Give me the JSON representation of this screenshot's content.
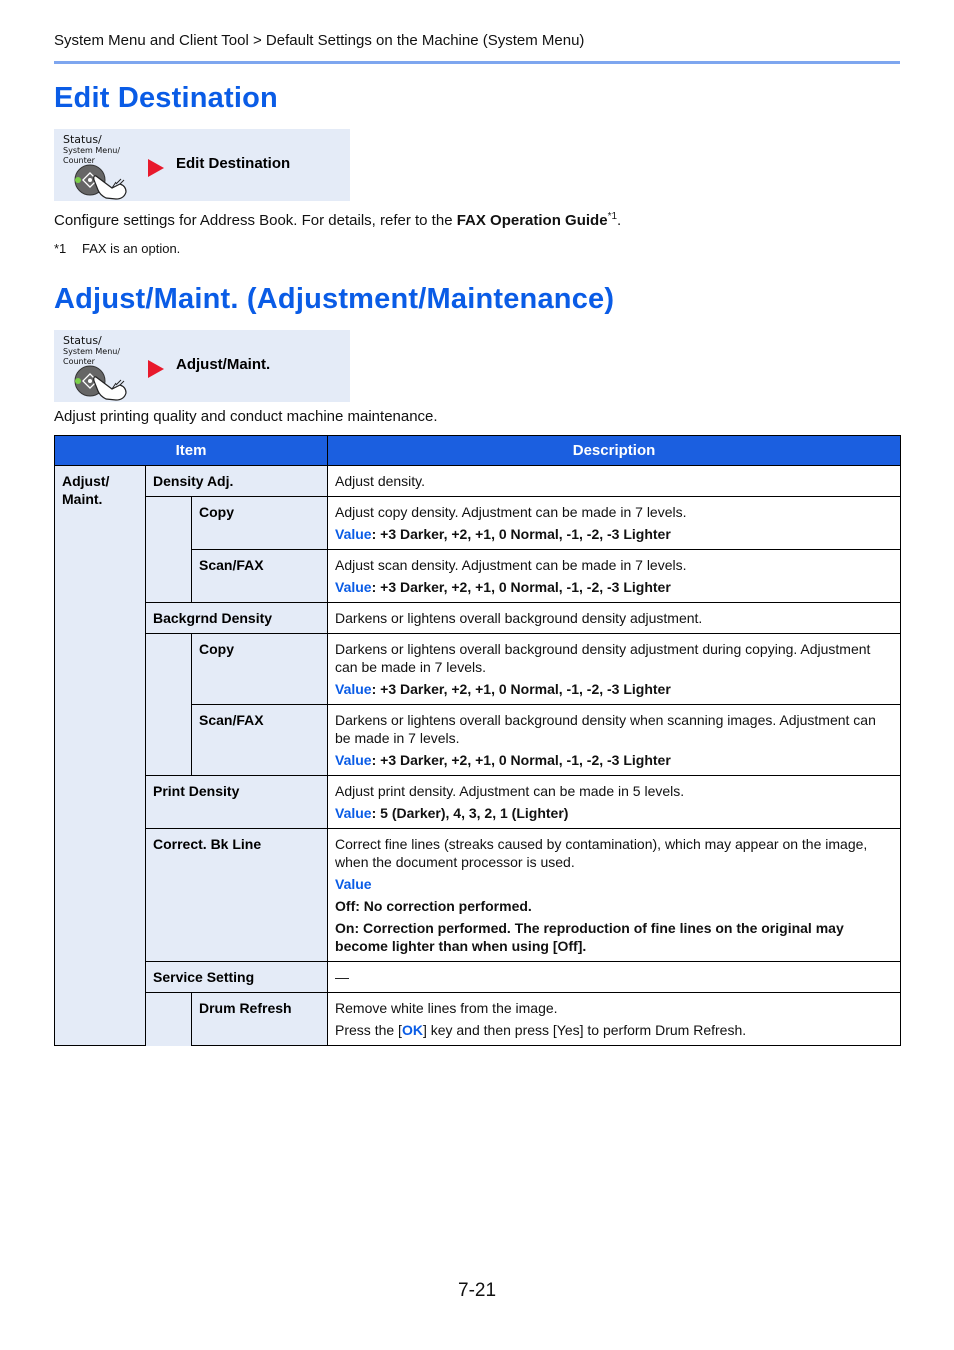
{
  "header": {
    "breadcrumb": "System Menu and Client Tool > Default Settings on the Machine (System Menu)"
  },
  "sections": [
    {
      "title": "Edit Destination",
      "nav": {
        "key_label_line1": "Status/",
        "key_label_line2": "System Menu/",
        "key_label_line3": "Counter",
        "path": "Edit Destination"
      },
      "body_prefix": "Configure settings for Address Book. For details, refer to the ",
      "body_bold": "FAX Operation Guide",
      "body_sup": "*1",
      "body_suffix": ".",
      "footnote_mark": "*1",
      "footnote_text": "FAX is an option."
    },
    {
      "title": "Adjust/Maint. (Adjustment/Maintenance)",
      "nav": {
        "key_label_line1": "Status/",
        "key_label_line2": "System Menu/",
        "key_label_line3": "Counter",
        "path": "Adjust/Maint."
      },
      "body": "Adjust printing quality and conduct machine maintenance."
    }
  ],
  "table": {
    "headers": {
      "item": "Item",
      "description": "Description"
    },
    "root_item": "Adjust/\nMaint.",
    "value_label": "Value",
    "rows": [
      {
        "level": 2,
        "item": "Density Adj.",
        "desc": "Adjust density."
      },
      {
        "level": 3,
        "item": "Copy",
        "desc": "Adjust copy density. Adjustment can be made in 7 levels.",
        "value": ": +3 Darker, +2, +1, 0 Normal, -1, -2, -3 Lighter"
      },
      {
        "level": 3,
        "item": "Scan/FAX",
        "desc": "Adjust scan density. Adjustment can be made in 7 levels.",
        "value": ": +3 Darker, +2, +1, 0 Normal, -1, -2, -3 Lighter"
      },
      {
        "level": 2,
        "item": "Backgrnd Density",
        "desc": "Darkens or lightens overall background density adjustment."
      },
      {
        "level": 3,
        "item": "Copy",
        "desc": "Darkens or lightens overall background density adjustment during copying. Adjustment can be made in 7 levels.",
        "value": ": +3 Darker, +2, +1, 0 Normal, -1, -2, -3 Lighter"
      },
      {
        "level": 3,
        "item": "Scan/FAX",
        "desc": "Darkens or lightens overall background density when scanning images. Adjustment can be made in 7 levels.",
        "value": ": +3 Darker, +2, +1, 0 Normal, -1, -2, -3 Lighter"
      },
      {
        "level": 2,
        "item": "Print Density",
        "desc": "Adjust print density. Adjustment can be made in 5 levels.",
        "value": ": 5 (Darker), 4, 3, 2, 1 (Lighter)"
      },
      {
        "level": 2,
        "item": "Correct. Bk Line",
        "desc": "Correct fine lines (streaks caused by contamination), which may appear on the image, when the document processor is used.",
        "value_heading": "Value",
        "options": [
          "Off: No correction performed.",
          "On: Correction performed. The reproduction of fine lines on the original may become lighter than when using [Off]."
        ]
      },
      {
        "level": 2,
        "item": "Service Setting",
        "desc": "—"
      },
      {
        "level": 3,
        "item": "Drum Refresh",
        "desc": "Remove white lines from the image.",
        "note_prefix": "Press the [",
        "note_key": "OK",
        "note_suffix": "] key and then press [Yes] to perform Drum Refresh."
      }
    ]
  },
  "footer": {
    "page_number": "7-21"
  },
  "colors": {
    "heading_blue": "#0a5ce6",
    "table_header_blue": "#1b5fe0",
    "item_bg": "#e4ebf7",
    "arrow_red": "#e8192c",
    "rule_blue": "#7ea6ef"
  }
}
